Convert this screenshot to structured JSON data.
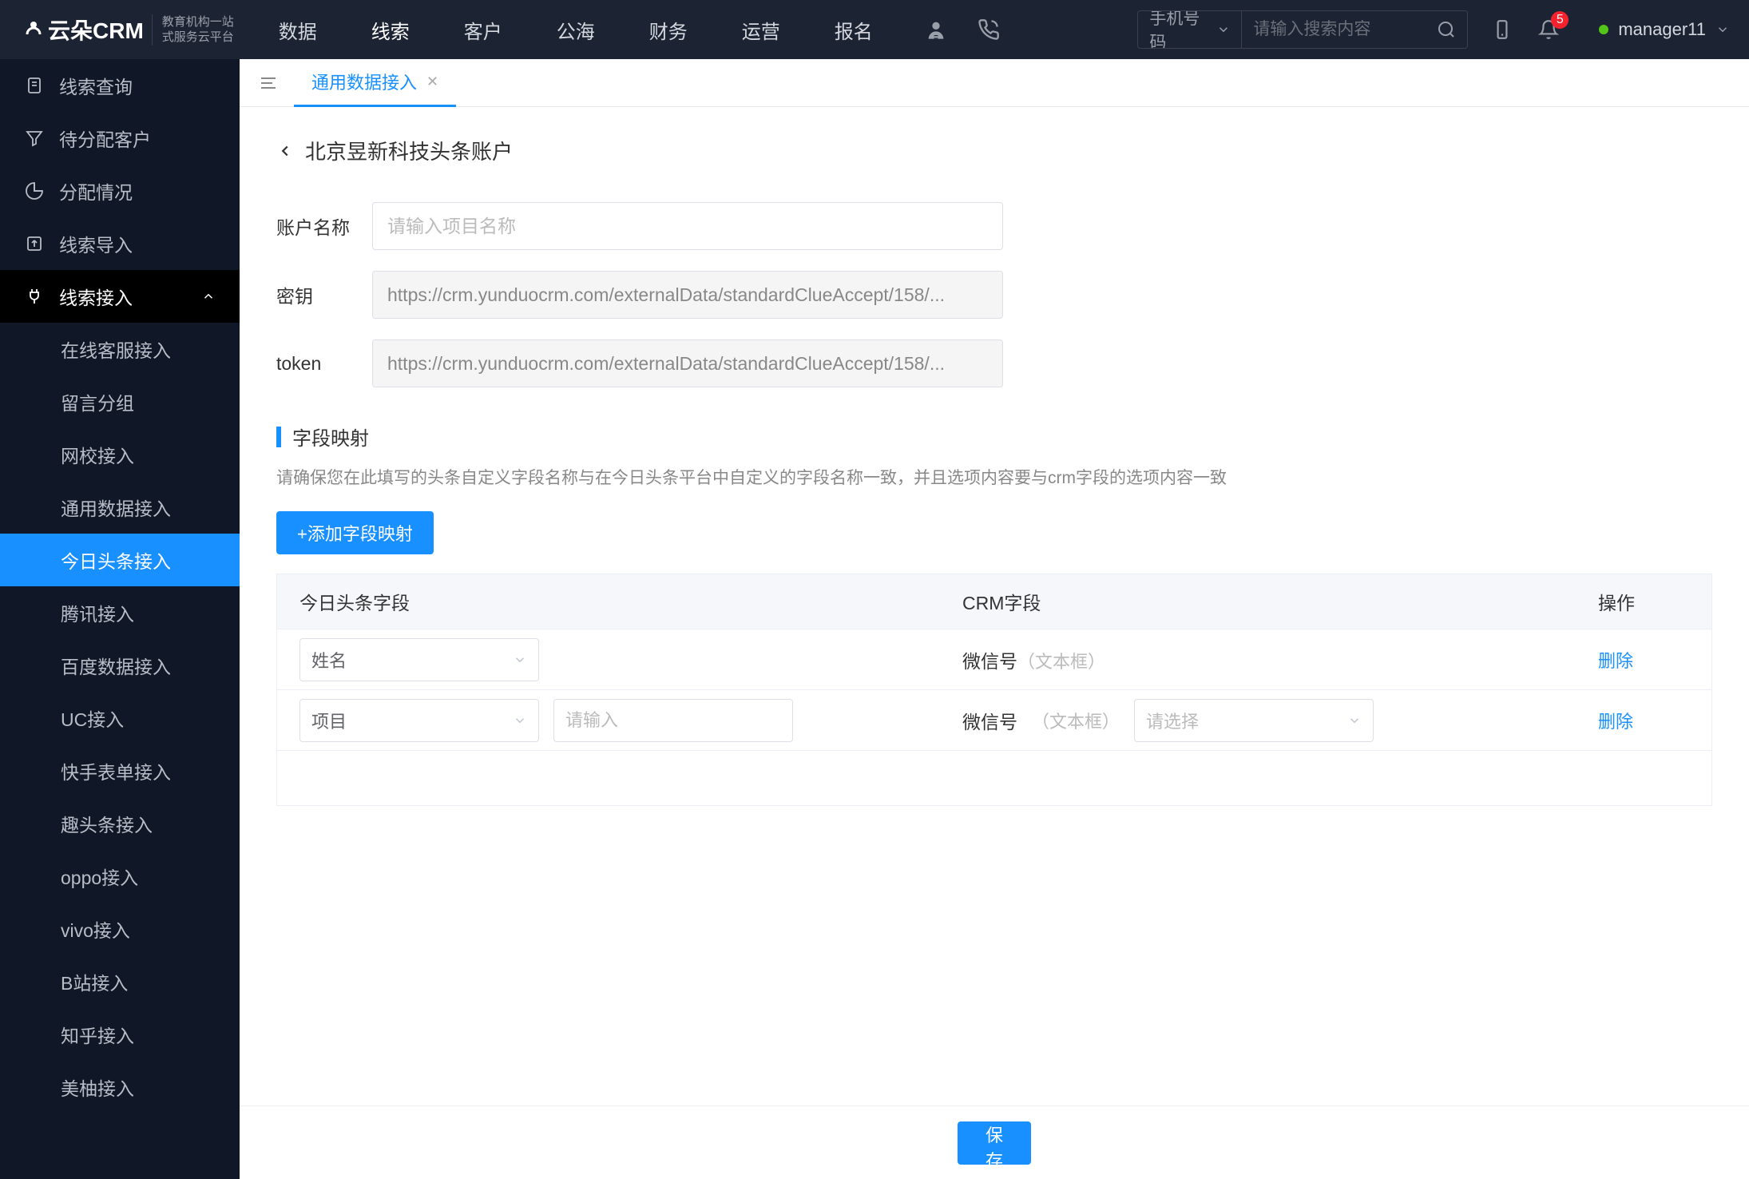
{
  "brand": {
    "name": "云朵CRM",
    "sub1": "教育机构一站",
    "sub2": "式服务云平台"
  },
  "nav": [
    "数据",
    "线索",
    "客户",
    "公海",
    "财务",
    "运营",
    "报名"
  ],
  "nav_active": 1,
  "search": {
    "type": "手机号码",
    "placeholder": "请输入搜索内容"
  },
  "notif_count": "5",
  "user": "manager11",
  "sidebar": [
    {
      "label": "线索查询",
      "icon": "document"
    },
    {
      "label": "待分配客户",
      "icon": "funnel"
    },
    {
      "label": "分配情况",
      "icon": "pie"
    },
    {
      "label": "线索导入",
      "icon": "export"
    },
    {
      "label": "线索接入",
      "icon": "plug",
      "expanded": true,
      "children": [
        {
          "label": "在线客服接入"
        },
        {
          "label": "留言分组"
        },
        {
          "label": "网校接入"
        },
        {
          "label": "通用数据接入"
        },
        {
          "label": "今日头条接入",
          "active": true
        },
        {
          "label": "腾讯接入"
        },
        {
          "label": "百度数据接入"
        },
        {
          "label": "UC接入"
        },
        {
          "label": "快手表单接入"
        },
        {
          "label": "趣头条接入"
        },
        {
          "label": "oppo接入"
        },
        {
          "label": "vivo接入"
        },
        {
          "label": "B站接入"
        },
        {
          "label": "知乎接入"
        },
        {
          "label": "美柚接入"
        }
      ]
    }
  ],
  "tab": {
    "label": "通用数据接入"
  },
  "page": {
    "title": "北京昱新科技头条账户",
    "account_label": "账户名称",
    "account_placeholder": "请输入项目名称",
    "secret_label": "密钥",
    "secret_value": "https://crm.yunduocrm.com/externalData/standardClueAccept/158/...",
    "token_label": "token",
    "token_value": "https://crm.yunduocrm.com/externalData/standardClueAccept/158/...",
    "section_title": "字段映射",
    "section_hint": "请确保您在此填写的头条自定义字段名称与在今日头条平台中自定义的字段名称一致，并且选项内容要与crm字段的选项内容一致",
    "add_btn": "+添加字段映射",
    "columns": [
      "今日头条字段",
      "CRM字段",
      "操作"
    ],
    "rows": [
      {
        "toutiao_sel": "姓名",
        "toutiao_input": null,
        "crm_label": "微信号",
        "crm_type": "（文本框）",
        "crm_sel": null,
        "action": "删除"
      },
      {
        "toutiao_sel": "项目",
        "toutiao_input": "",
        "crm_label": "微信号",
        "crm_type": "（文本框）",
        "crm_sel": "",
        "action": "删除"
      }
    ],
    "input_placeholder": "请输入",
    "select_placeholder": "请选择",
    "save": "保存"
  }
}
